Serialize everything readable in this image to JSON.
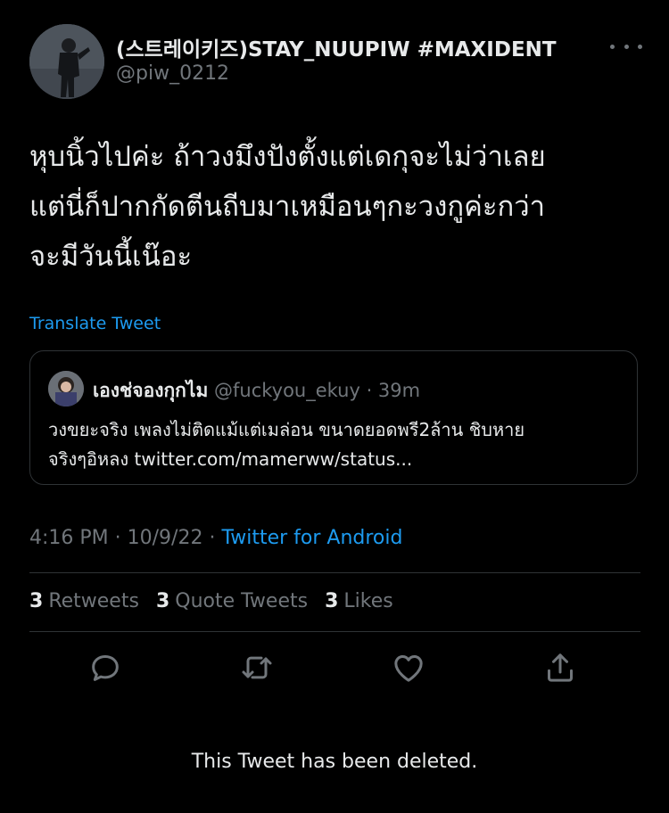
{
  "tweet": {
    "author_name": "(스트레이키즈)STAY_NUUPIW #MAXIDENT",
    "author_handle": "@piw_0212",
    "text_lines": [
      "หุบนิ้วไปค่ะ ถ้าวงมึงปังตั้งแต่เดกุจะไม่ว่าเลย",
      "แต่นี่ก็ปากกัดตีนถีบมาเหมือนๆกะวงกูค่ะกว่า",
      "จะมีวันนี้เน๊อะ"
    ],
    "translate_label": "Translate Tweet",
    "time": "4:16 PM",
    "separator": " · ",
    "date": "10/9/22",
    "source": "Twitter for Android"
  },
  "quoted": {
    "name": "เองช่จองกุกไม",
    "meta": " @fuckyou_ekuy · 39m",
    "text_lines": [
      "วงขยะจริง เพลงไม่ติดแม้แต่เมล่อน ขนาดยอดพรี2ล้าน ชิบหาย",
      "จริงๆอิหลง twitter.com/mamerww/status..."
    ]
  },
  "stats": {
    "retweets_count": "3",
    "retweets_label": "Retweets",
    "quotes_count": "3",
    "quotes_label": "Quote Tweets",
    "likes_count": "3",
    "likes_label": "Likes"
  },
  "icons": {
    "reply": "reply-icon",
    "retweet": "retweet-icon",
    "like": "like-icon",
    "share": "share-icon",
    "more": "more-icon"
  },
  "colors": {
    "background": "#000000",
    "text": "#e7e9ea",
    "muted": "#71767b",
    "accent": "#1d9bf0",
    "border": "#2f3336"
  },
  "footer": {
    "deleted_notice": "This Tweet has been deleted."
  }
}
